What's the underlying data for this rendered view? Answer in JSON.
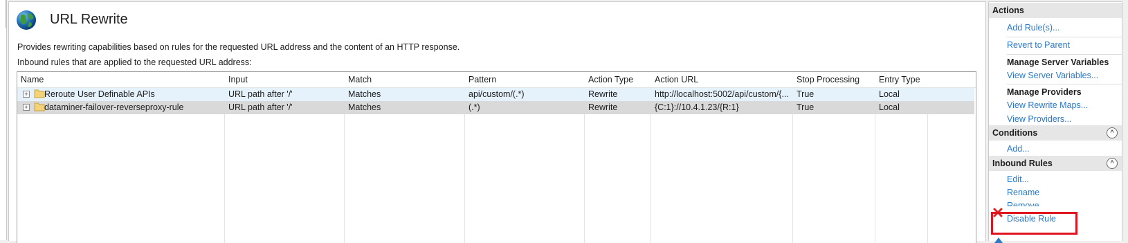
{
  "main": {
    "title": "URL Rewrite",
    "description": "Provides rewriting capabilities based on rules for the requested URL address and the content of an HTTP response.",
    "subdescription": "Inbound rules that are applied to the requested URL address:",
    "icon": "globe-icon"
  },
  "grid": {
    "columns": [
      "Name",
      "Input",
      "Match",
      "Pattern",
      "Action Type",
      "Action URL",
      "Stop Processing",
      "Entry Type"
    ],
    "rows": [
      {
        "name": "Reroute User Definable APIs",
        "input": "URL path after '/'",
        "match": "Matches",
        "pattern": "api/custom/(.*)",
        "action_type": "Rewrite",
        "action_url": "http://localhost:5002/api/custom/{...",
        "stop_processing": "True",
        "entry_type": "Local"
      },
      {
        "name": "dataminer-failover-reverseproxy-rule",
        "input": "URL path after '/'",
        "match": "Matches",
        "pattern": "(.*)",
        "action_type": "Rewrite",
        "action_url": "{C:1}://10.4.1.23/{R:1}",
        "stop_processing": "True",
        "entry_type": "Local"
      }
    ],
    "expander_glyph": "+"
  },
  "actions": {
    "header": "Actions",
    "add_rules": "Add Rule(s)...",
    "revert_to_parent": "Revert to Parent",
    "manage_server_variables": "Manage Server Variables",
    "view_server_variables": "View Server Variables...",
    "manage_providers": "Manage Providers",
    "view_rewrite_maps": "View Rewrite Maps...",
    "view_providers": "View Providers...",
    "conditions": "Conditions",
    "add": "Add...",
    "inbound_rules": "Inbound Rules",
    "edit": "Edit...",
    "rename": "Rename",
    "remove": "Remove",
    "disable_rule": "Disable Rule",
    "collapse_glyph": "^"
  },
  "colors": {
    "link": "#2b79c7",
    "selected_row": "#e5f1fb",
    "second_row": "#d9d9d9",
    "highlight": "#e0141e"
  }
}
